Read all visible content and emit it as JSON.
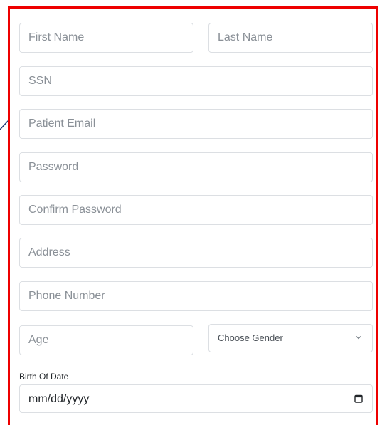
{
  "form": {
    "first_name": {
      "placeholder": "First Name",
      "value": ""
    },
    "last_name": {
      "placeholder": "Last Name",
      "value": ""
    },
    "ssn": {
      "placeholder": "SSN",
      "value": ""
    },
    "patient_email": {
      "placeholder": "Patient Email",
      "value": ""
    },
    "password": {
      "placeholder": "Password",
      "value": ""
    },
    "confirm_password": {
      "placeholder": "Confirm Password",
      "value": ""
    },
    "address": {
      "placeholder": "Address",
      "value": ""
    },
    "phone_number": {
      "placeholder": "Phone Number",
      "value": ""
    },
    "age": {
      "placeholder": "Age",
      "value": ""
    },
    "gender": {
      "selected": "Choose Gender"
    },
    "birth_date": {
      "label": "Birth Of Date",
      "placeholder": "mm/dd/yyyy"
    }
  },
  "icons": {
    "chevron": "chevron-down-icon",
    "calendar": "calendar-icon"
  },
  "colors": {
    "frame_border": "#ee0000",
    "pointer_line": "#1f3b73",
    "field_border": "#dcdfe3",
    "placeholder": "#8a9097"
  }
}
